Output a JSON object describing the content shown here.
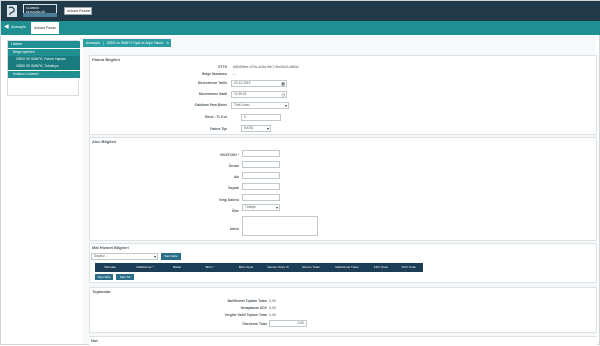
{
  "app": {
    "brand_line1": "GÜMRÜK MÜŞAVİRLİĞİ",
    "brand_line2": "",
    "company_select": "Ankara Pazarı",
    "back_label": "◀",
    "tab_home": "Anasayfa",
    "tab_active": "Ankara Pazarı"
  },
  "sidebar": {
    "header": "Listeler",
    "items": [
      {
        "label": "Belge İşlemleri"
      },
      {
        "label": "GİBSİ VE SMM'Yİ, Fatura Yapılan"
      },
      {
        "label": "GİBSİ VE SMM'Yİ, Tutulduyu"
      },
      {
        "label": "Kullanıcı Listesini"
      }
    ]
  },
  "main_tab": {
    "part1": "Anasayfa",
    "part2": "GİBSİ ve SMM'Yİ Fiyat ve Arşiv Fatura",
    "close": "✕"
  },
  "invoice": {
    "title": "Fatura Bilgileri",
    "ettn_label": "ETTN",
    "ettn_value": "b80d06ee-07bc-4c5a-9fe7-9ee0b21c660d",
    "belge_no_label": "Belge Numarası",
    "belge_no_value": "---",
    "duzenleme_tarihi_label": "Düzenlenme Tarihi",
    "duzenleme_tarihi_value": "20.12.2019",
    "duzenleme_saati_label": "Düzenlenme Saati",
    "duzenleme_saati_value": "11:35:31",
    "para_birimi_label": "Dakikam Para Birimi",
    "para_birimi_value": "Türk Lirası",
    "doviz_label": "Döviz - TL Kur",
    "doviz_value": "0",
    "fatura_tipi_label": "Fatura Tipi",
    "fatura_tipi_value": "SATIŞ"
  },
  "buyer": {
    "title": "Alıcı Bilgileri",
    "vkn_label": "VKN/TCKN *",
    "unvan_label": "Ünvan",
    "adi_label": "Adı",
    "soyadi_label": "Soyadı",
    "vergi_dairesi_label": "Vergi Dairesi",
    "ulke_label": "Ülke",
    "ulke_value": "Türkiye",
    "adres_label": "Adres"
  },
  "goods": {
    "title": "Mal Hizmet Bilgileri",
    "select_value": "Seçiniz...",
    "add_button": "Satır Ekle",
    "headers": [
      "Sil/sırala",
      "Mal/Hizmet *",
      "Miktar",
      "Birim *",
      "Birim Fiyat",
      "İskonto Oranı %",
      "İskonto Tutarı",
      "Mal/Hizmet Tutarı",
      "KDV Oranı",
      "KDV Tutarı"
    ],
    "btn_add": "Satır Ekle",
    "btn_delete": "Satır Sil"
  },
  "totals": {
    "title": "Toplamlar",
    "rows": [
      {
        "label": "Mal/Hizmet Toplam Tutarı",
        "value": "0,00"
      },
      {
        "label": "Hesaplanan KDV",
        "value": "0,00"
      },
      {
        "label": "Vergiler Dahil Toplam Tutar",
        "value": "0,00"
      },
      {
        "label": "Ödenecek Tutar",
        "value": "0,00"
      }
    ]
  },
  "notes": {
    "title": "Not"
  },
  "colors": {
    "topbar": "#203a49",
    "tabsbar": "#1f8f92",
    "table_head": "#1b3d55",
    "button": "#2a6f8a"
  }
}
